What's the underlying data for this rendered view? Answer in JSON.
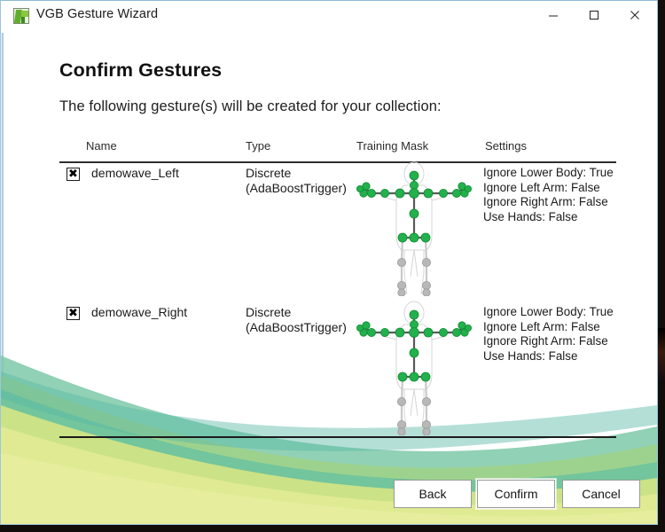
{
  "window": {
    "title": "VGB Gesture Wizard",
    "icon": "app-icon",
    "controls": {
      "minimize": "minimize-icon",
      "maximize": "maximize-icon",
      "close": "close-icon"
    }
  },
  "page": {
    "heading": "Confirm Gestures",
    "subheading": "The following gesture(s) will be created for your collection:"
  },
  "table": {
    "columns": {
      "name": "Name",
      "type": "Type",
      "mask": "Training Mask",
      "settings": "Settings"
    },
    "rows": [
      {
        "checked": true,
        "check_glyph": "✖",
        "name": "demowave_Left",
        "type": "Discrete\n(AdaBoostTrigger)",
        "settings": "Ignore Lower Body: True\nIgnore Left Arm: False\nIgnore Right Arm: False\nUse Hands: False",
        "mask": "skeleton-upper-body-mask"
      },
      {
        "checked": true,
        "check_glyph": "✖",
        "name": "demowave_Right",
        "type": "Discrete\n(AdaBoostTrigger)",
        "settings": "Ignore Lower Body: True\nIgnore Left Arm: False\nIgnore Right Arm: False\nUse Hands: False",
        "mask": "skeleton-upper-body-mask"
      }
    ]
  },
  "footer": {
    "back": "Back",
    "confirm": "Confirm",
    "cancel": "Cancel"
  },
  "colors": {
    "joint_active": "#22b14c",
    "joint_inactive": "#b8b8b8",
    "bone_active": "#555555",
    "bone_inactive": "#c9c9c9",
    "wave_teal": "#6cc6b0",
    "wave_green": "#8fc97a",
    "wave_yellow": "#d9e58a",
    "wave_pale": "#e5eea0",
    "window_border": "#9fc4dd"
  }
}
